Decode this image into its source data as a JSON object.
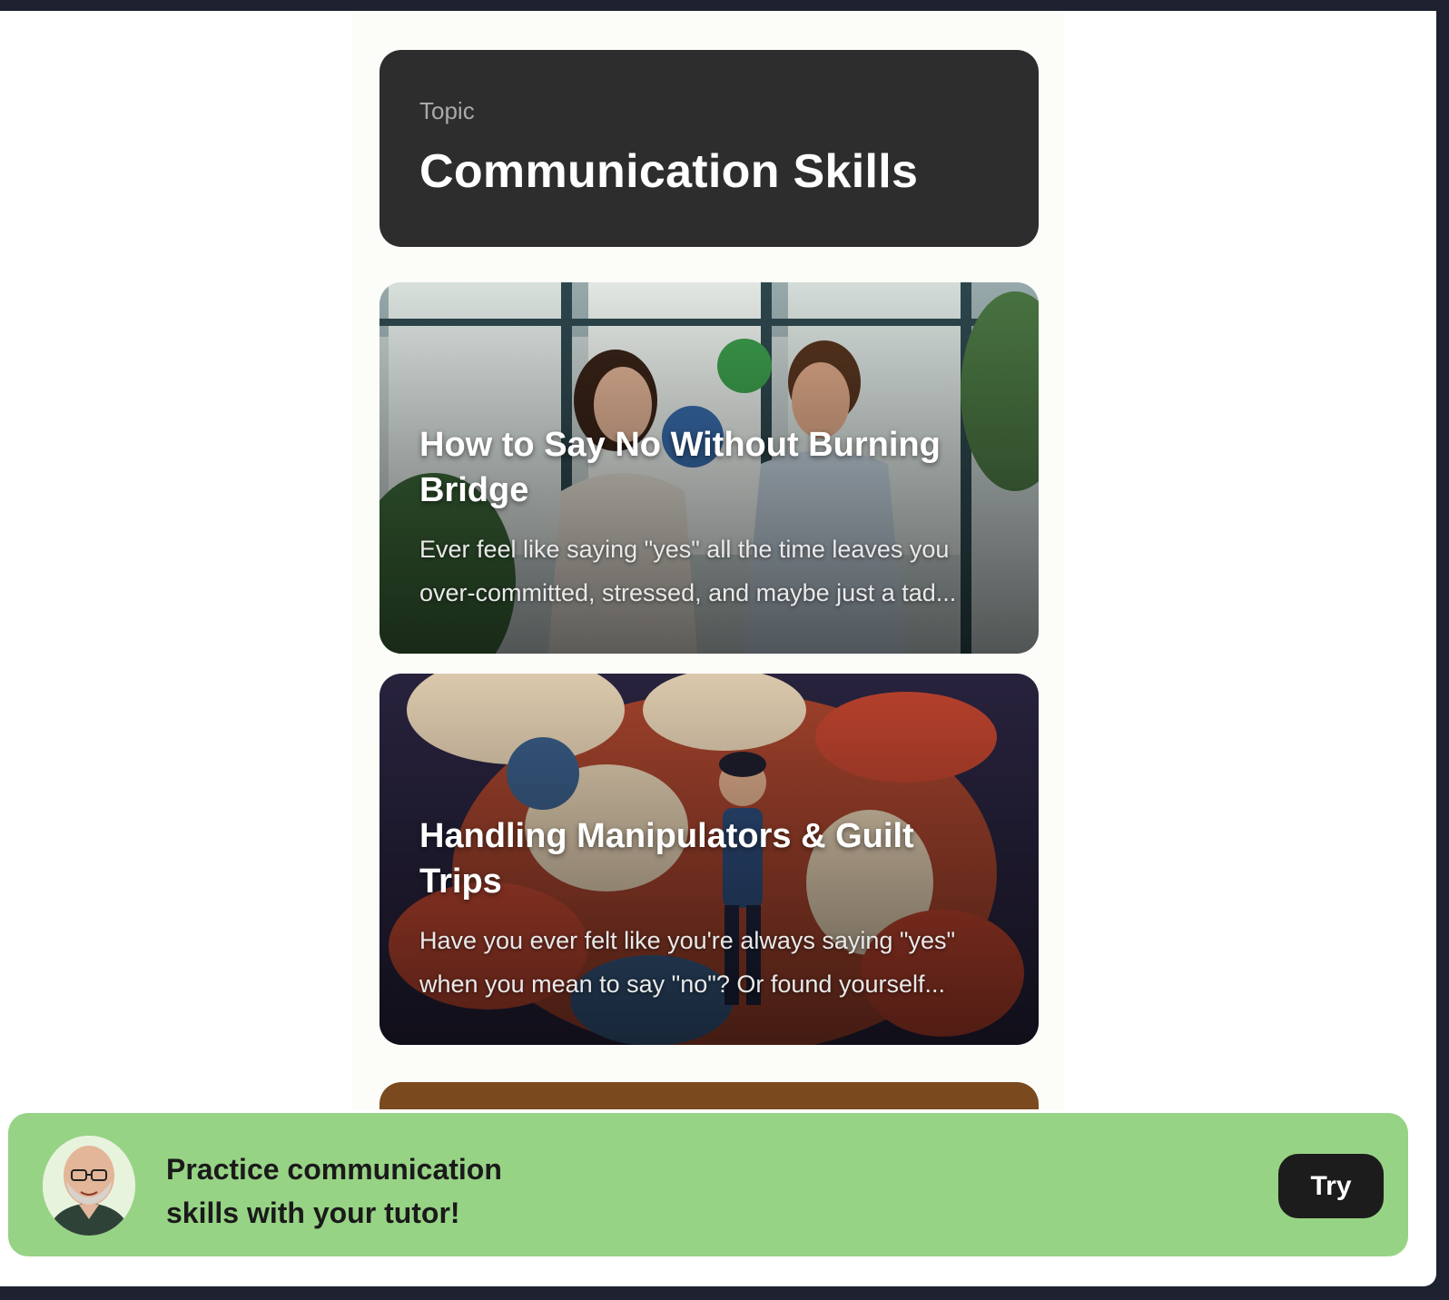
{
  "topic": {
    "label": "Topic",
    "title": "Communication Skills"
  },
  "lessons": [
    {
      "title": "How to Say No Without Burning Bridge",
      "description": "Ever feel like saying \"yes\" all the time leaves you over-committed, stressed, and maybe just a tad..."
    },
    {
      "title": "Handling Manipulators & Guilt Trips",
      "description": "Have you ever felt like you're always saying \"yes\" when you mean to say \"no\"? Or found yourself..."
    }
  ],
  "banner": {
    "message": "Practice communication skills with your tutor!",
    "button_label": "Try"
  },
  "colors": {
    "topic_card": "#2d2d2d",
    "banner": "#97d385",
    "button": "#1c1c1c"
  }
}
